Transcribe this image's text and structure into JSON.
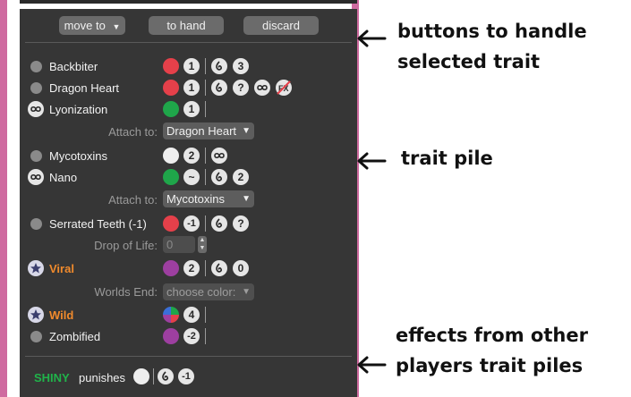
{
  "toolbar": {
    "move_to_label": "move to",
    "to_hand_label": "to hand",
    "discard_label": "discard"
  },
  "colors": {
    "pink_border": "#cf6ba0",
    "panel_bg": "#363636",
    "red": "#e5404a",
    "green": "#1fa64a",
    "purple": "#9d3fa0",
    "white": "#eeeeee",
    "orange_text": "#f08a2c",
    "shiny_green": "#20b34a"
  },
  "traits": [
    {
      "name": "Backbiter",
      "icon": "gray-dot",
      "color": "red",
      "cost": "1",
      "effects": [
        "food-swirl-icon",
        "3"
      ]
    },
    {
      "name": "Dragon Heart",
      "icon": "gray-dot",
      "color": "red",
      "cost": "1",
      "effects": [
        "food-swirl-icon",
        "?",
        "infinity-icon",
        "fx-icon"
      ]
    },
    {
      "name": "Lyonization",
      "icon": "infinity-icon",
      "color": "green",
      "cost": "1",
      "effects": []
    },
    {
      "name": "Mycotoxins",
      "icon": "gray-dot",
      "color": "white",
      "cost": "2",
      "effects": [
        "infinity-icon"
      ]
    },
    {
      "name": "Nano",
      "icon": "infinity-icon",
      "color": "green",
      "cost": "~",
      "effects": [
        "food-swirl-icon",
        "2"
      ]
    },
    {
      "name": "Serrated Teeth (-1)",
      "icon": "gray-dot",
      "color": "red",
      "cost": "-1",
      "effects": [
        "food-swirl-icon",
        "?"
      ]
    },
    {
      "name": "Viral",
      "icon": "star-icon",
      "color": "purple",
      "cost": "2",
      "effects": [
        "food-swirl-icon",
        "0"
      ]
    },
    {
      "name": "Wild",
      "icon": "star-icon",
      "color": "multi",
      "cost": "4",
      "effects": []
    },
    {
      "name": "Zombified",
      "icon": "gray-dot",
      "color": "purple",
      "cost": "-2",
      "effects": []
    }
  ],
  "attach_1": {
    "label": "Attach to:",
    "value": "Dragon Heart"
  },
  "attach_2": {
    "label": "Attach to:",
    "value": "Mycotoxins"
  },
  "drop_of_life": {
    "label": "Drop of Life:",
    "value": "0"
  },
  "worlds_end": {
    "label": "Worlds End:",
    "value": "choose color:"
  },
  "footer": {
    "player": "SHINY",
    "verb": "punishes",
    "value": "-1"
  },
  "annotations": {
    "a1_line1": "buttons to handle",
    "a1_line2": "selected trait",
    "a2": "trait pile",
    "a3_line1": "effects from other",
    "a3_line2": "players trait piles"
  }
}
